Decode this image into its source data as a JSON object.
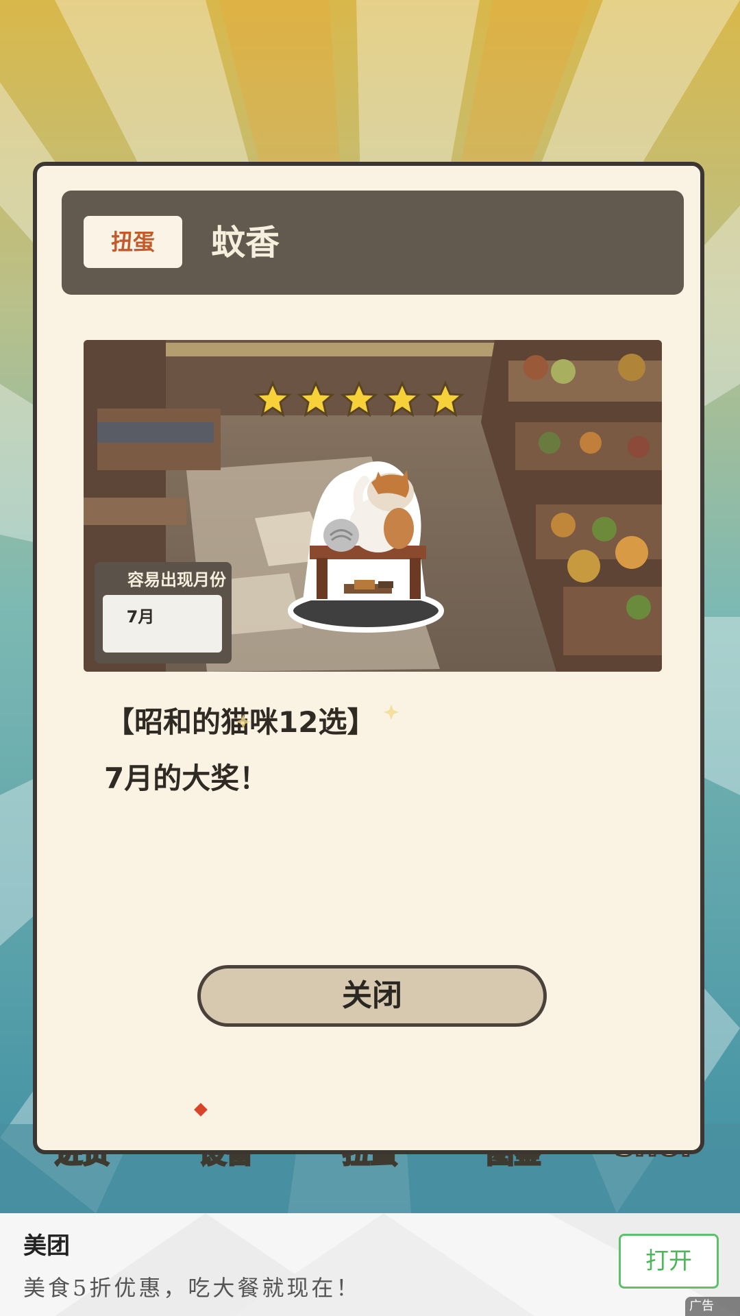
{
  "colors": {
    "modal_bg": "#faf2e2",
    "header_bg": "#625a4f",
    "badge_text": "#c35a2c",
    "close_button_bg": "#d6c9b0",
    "ad_green": "#4db55a"
  },
  "background_nav": {
    "items": [
      "进货",
      "设备",
      "扭蛋",
      "图鉴",
      "SHOP"
    ]
  },
  "modal": {
    "category_badge": "扭蛋",
    "title": "蚊香",
    "rarity_stars": 5,
    "month_label": "容易出现月份",
    "month_value": "7月",
    "description_line1": "【昭和的猫咪12选】",
    "description_line2": "7月的大奖！",
    "close_label": "关闭",
    "icons": {
      "star": "star-icon",
      "item": "cat-mosquito-coil-figure"
    }
  },
  "ad": {
    "brand": "美团",
    "text": "美食5折优惠，吃大餐就现在！",
    "open_label": "打开",
    "tag": "广告"
  }
}
